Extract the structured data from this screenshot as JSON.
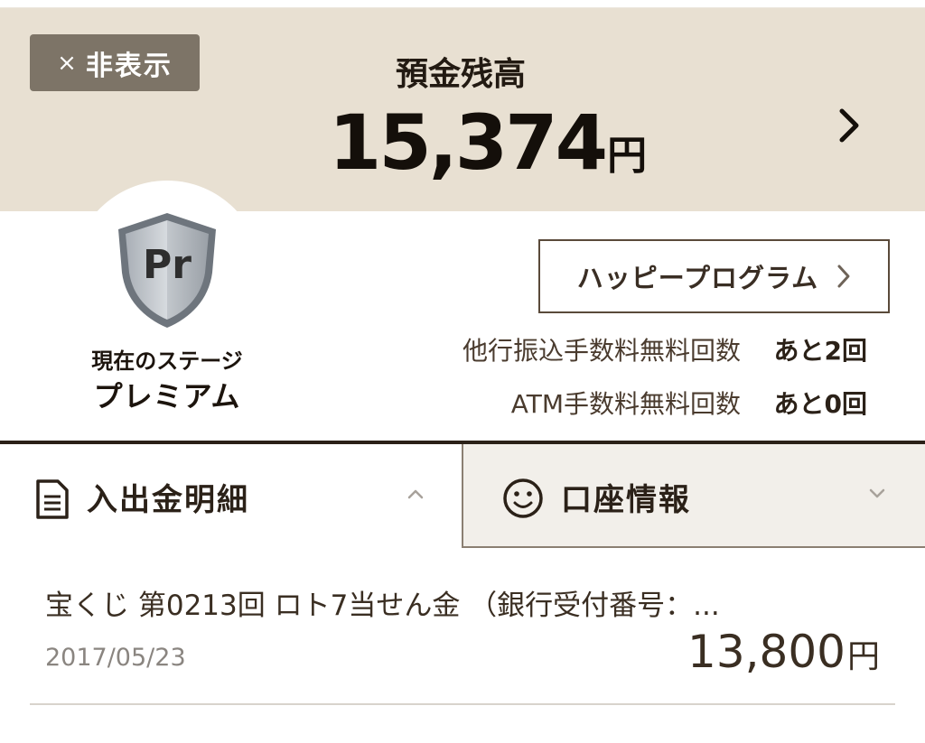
{
  "balance": {
    "hide_label": "非表示",
    "hide_icon": "close-icon",
    "title": "預金残高",
    "amount": "15,374",
    "currency": "円"
  },
  "stage": {
    "badge_text": "Pr",
    "label": "現在のステージ",
    "name": "プレミアム"
  },
  "happy_program": {
    "label": "ハッピープログラム"
  },
  "fees": [
    {
      "label": "他行振込手数料無料回数",
      "value": "あと2回"
    },
    {
      "label": "ATM手数料無料回数",
      "value": "あと0回"
    }
  ],
  "tabs": [
    {
      "label": "入出金明細",
      "icon": "document-icon",
      "state": "expanded"
    },
    {
      "label": "口座情報",
      "icon": "smiley-icon",
      "state": "collapsed"
    }
  ],
  "transactions": [
    {
      "description": "宝くじ 第0213回 ロト7当せん金 （銀行受付番号：...",
      "date": "2017/05/23",
      "amount": "13,800",
      "currency": "円"
    }
  ],
  "colors": {
    "header_bg": "#e8e0d2",
    "hide_button_bg": "#7d7467",
    "text_primary": "#2b2118",
    "inactive_tab_bg": "#f2efea"
  }
}
